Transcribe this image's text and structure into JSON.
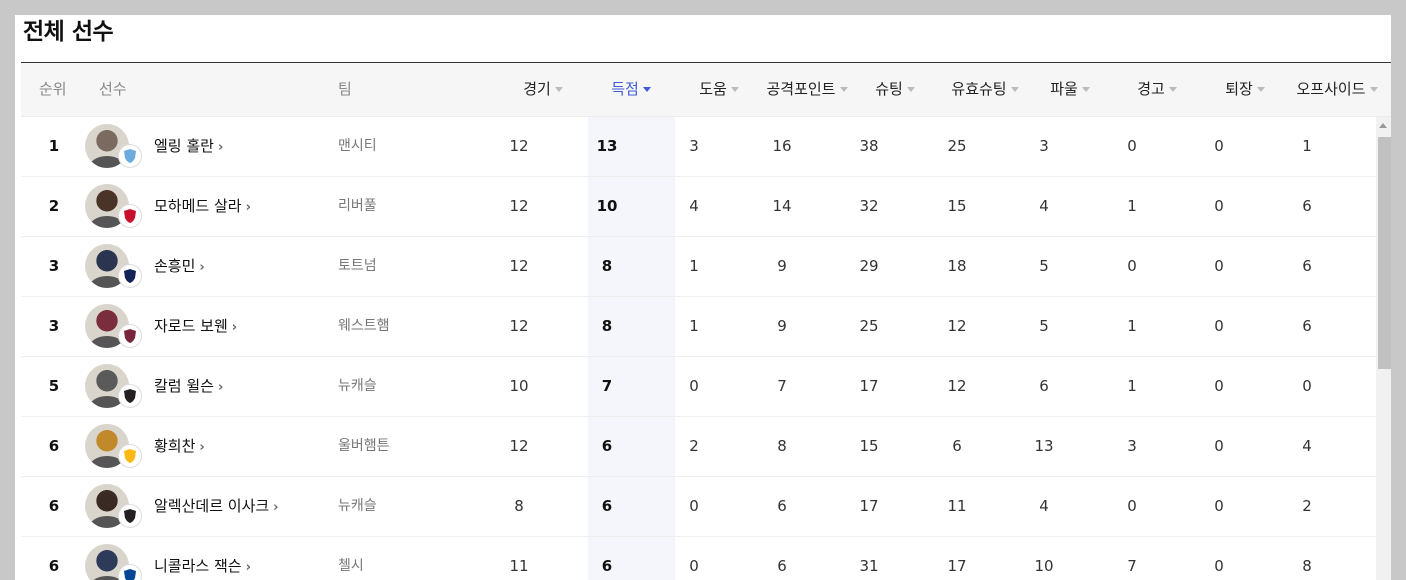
{
  "title": "전체 선수",
  "columns": {
    "rank": "순위",
    "player": "선수",
    "team": "팀",
    "games": "경기",
    "goals": "득점",
    "assists": "도움",
    "points": "공격포인트",
    "shots": "슈팅",
    "shots_on": "유효슈팅",
    "fouls": "파울",
    "yellow": "경고",
    "red": "퇴장",
    "offside": "오프사이드"
  },
  "colors": {
    "active_sort": "#3d5bd6",
    "header_bg": "#f6f6f6",
    "sorted_col_bg": "#f4f6fc"
  },
  "players": [
    {
      "rank": "1",
      "name": "엘링 홀란",
      "team": "맨시티",
      "games": "12",
      "goals": "13",
      "assists": "3",
      "points": "16",
      "shots": "38",
      "shots_on": "25",
      "fouls": "3",
      "yellow": "0",
      "red": "0",
      "offside": "1",
      "face": "#7a6a60",
      "badge": "#6cabdd",
      "badge_icon": "mancity-crest-icon"
    },
    {
      "rank": "2",
      "name": "모하메드 살라",
      "team": "리버풀",
      "games": "12",
      "goals": "10",
      "assists": "4",
      "points": "14",
      "shots": "32",
      "shots_on": "15",
      "fouls": "4",
      "yellow": "1",
      "red": "0",
      "offside": "6",
      "face": "#4a3428",
      "badge": "#c8102e",
      "badge_icon": "liverpool-crest-icon"
    },
    {
      "rank": "3",
      "name": "손흥민",
      "team": "토트넘",
      "games": "12",
      "goals": "8",
      "assists": "1",
      "points": "9",
      "shots": "29",
      "shots_on": "18",
      "fouls": "5",
      "yellow": "0",
      "red": "0",
      "offside": "6",
      "face": "#2b3550",
      "badge": "#132257",
      "badge_icon": "tottenham-crest-icon"
    },
    {
      "rank": "3",
      "name": "자로드 보웬",
      "team": "웨스트햄",
      "games": "12",
      "goals": "8",
      "assists": "1",
      "points": "9",
      "shots": "25",
      "shots_on": "12",
      "fouls": "5",
      "yellow": "1",
      "red": "0",
      "offside": "6",
      "face": "#7a2d3c",
      "badge": "#7a263a",
      "badge_icon": "westham-crest-icon"
    },
    {
      "rank": "5",
      "name": "칼럼 윌슨",
      "team": "뉴캐슬",
      "games": "10",
      "goals": "7",
      "assists": "0",
      "points": "7",
      "shots": "17",
      "shots_on": "12",
      "fouls": "6",
      "yellow": "1",
      "red": "0",
      "offside": "0",
      "face": "#5a5a5a",
      "badge": "#241f20",
      "badge_icon": "newcastle-crest-icon"
    },
    {
      "rank": "6",
      "name": "황희찬",
      "team": "울버햄튼",
      "games": "12",
      "goals": "6",
      "assists": "2",
      "points": "8",
      "shots": "15",
      "shots_on": "6",
      "fouls": "13",
      "yellow": "3",
      "red": "0",
      "offside": "4",
      "face": "#c08a2a",
      "badge": "#fdb913",
      "badge_icon": "wolves-crest-icon"
    },
    {
      "rank": "6",
      "name": "알렉산데르 이사크",
      "team": "뉴캐슬",
      "games": "8",
      "goals": "6",
      "assists": "0",
      "points": "6",
      "shots": "17",
      "shots_on": "11",
      "fouls": "4",
      "yellow": "0",
      "red": "0",
      "offside": "2",
      "face": "#3a2a24",
      "badge": "#241f20",
      "badge_icon": "newcastle-crest-icon"
    },
    {
      "rank": "6",
      "name": "니콜라스 잭슨",
      "team": "첼시",
      "games": "11",
      "goals": "6",
      "assists": "0",
      "points": "6",
      "shots": "31",
      "shots_on": "17",
      "fouls": "10",
      "yellow": "7",
      "red": "0",
      "offside": "8",
      "face": "#2e3a5a",
      "badge": "#034694",
      "badge_icon": "chelsea-crest-icon"
    }
  ]
}
